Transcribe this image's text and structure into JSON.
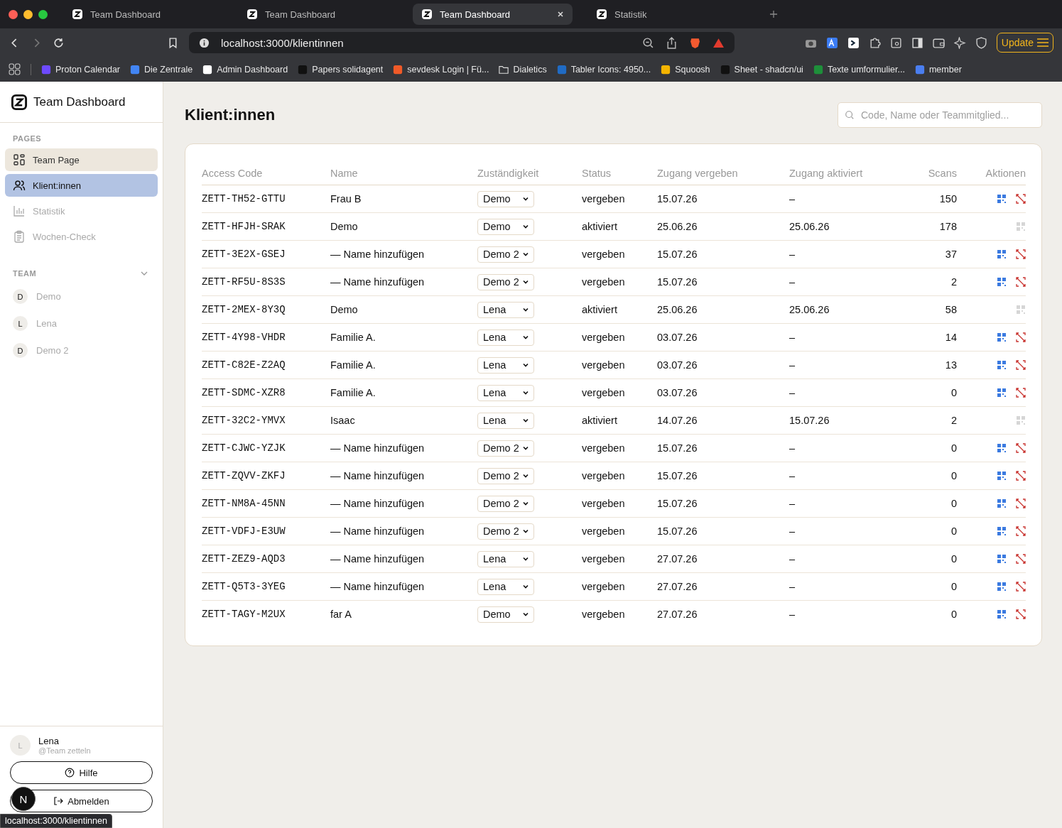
{
  "browser": {
    "tabs": [
      {
        "title": "Team Dashboard",
        "selected": false
      },
      {
        "title": "Team Dashboard",
        "selected": false
      },
      {
        "title": "Team Dashboard",
        "selected": true
      },
      {
        "title": "Statistik",
        "selected": false
      }
    ],
    "address": "localhost:3000/klientinnen",
    "update_button": "Update",
    "bookmarks": [
      {
        "label": "Proton Calendar",
        "kind": "site",
        "color": "#6d4aff"
      },
      {
        "label": "Die Zentrale",
        "kind": "site",
        "color": "#4285f4"
      },
      {
        "label": "Admin Dashboard",
        "kind": "site",
        "color": "#ffffff"
      },
      {
        "label": "Papers solidagent",
        "kind": "site",
        "color": "#111111"
      },
      {
        "label": "sevdesk Login | Fü...",
        "kind": "site",
        "color": "#f05a28"
      },
      {
        "label": "Dialetics",
        "kind": "folder",
        "color": "#dddddd"
      },
      {
        "label": "Tabler Icons: 4950...",
        "kind": "site",
        "color": "#206bc4"
      },
      {
        "label": "Squoosh",
        "kind": "site",
        "color": "#f4b400"
      },
      {
        "label": "Sheet - shadcn/ui",
        "kind": "site",
        "color": "#111111"
      },
      {
        "label": "Texte umformulier...",
        "kind": "site",
        "color": "#1e8f3a"
      },
      {
        "label": "member",
        "kind": "site",
        "color": "#4a7ef0"
      }
    ]
  },
  "sidebar": {
    "title": "Team Dashboard",
    "pages_heading": "PAGES",
    "pages": [
      {
        "label": "Team Page",
        "selected": false,
        "hovered": true
      },
      {
        "label": "Klient:innen",
        "selected": true,
        "hovered": false
      },
      {
        "label": "Statistik",
        "selected": false,
        "hovered": false
      },
      {
        "label": "Wochen-Check",
        "selected": false,
        "hovered": false
      }
    ],
    "team_heading": "TEAM",
    "team_expanded": true,
    "team": [
      {
        "initial": "D",
        "name": "Demo"
      },
      {
        "initial": "L",
        "name": "Lena"
      },
      {
        "initial": "D",
        "name": "Demo 2"
      }
    ],
    "user": {
      "initial": "L",
      "name": "Lena",
      "handle": "@Team zetteln"
    },
    "help_button": "Hilfe",
    "logout_button": "Abmelden"
  },
  "page": {
    "title": "Klient:innen",
    "search": {
      "placeholder": "Code, Name oder Teammitglied..."
    }
  },
  "table": {
    "columns": [
      "Access Code",
      "Name",
      "Zuständigkeit",
      "Status",
      "Zugang vergeben",
      "Zugang aktiviert",
      "Scans",
      "Aktionen"
    ],
    "rows": [
      {
        "code": "ZETT-TH52-GTTU",
        "name": "Frau B",
        "assignee": "Demo",
        "status": "vergeben",
        "issued": "15.07.26",
        "activated": "–",
        "scans": "150",
        "actions_enabled": true
      },
      {
        "code": "ZETT-HFJH-SRAK",
        "name": "Demo",
        "assignee": "Demo",
        "status": "aktiviert",
        "issued": "25.06.26",
        "activated": "25.06.26",
        "scans": "178",
        "actions_enabled": false
      },
      {
        "code": "ZETT-3E2X-GSEJ",
        "name": "— Name hinzufügen",
        "assignee": "Demo 2",
        "status": "vergeben",
        "issued": "15.07.26",
        "activated": "–",
        "scans": "37",
        "actions_enabled": true
      },
      {
        "code": "ZETT-RF5U-8S3S",
        "name": "— Name hinzufügen",
        "assignee": "Demo 2",
        "status": "vergeben",
        "issued": "15.07.26",
        "activated": "–",
        "scans": "2",
        "actions_enabled": true
      },
      {
        "code": "ZETT-2MEX-8Y3Q",
        "name": "Demo",
        "assignee": "Lena",
        "status": "aktiviert",
        "issued": "25.06.26",
        "activated": "25.06.26",
        "scans": "58",
        "actions_enabled": false
      },
      {
        "code": "ZETT-4Y98-VHDR",
        "name": "Familie A.",
        "assignee": "Lena",
        "status": "vergeben",
        "issued": "03.07.26",
        "activated": "–",
        "scans": "14",
        "actions_enabled": true
      },
      {
        "code": "ZETT-C82E-Z2AQ",
        "name": "Familie A.",
        "assignee": "Lena",
        "status": "vergeben",
        "issued": "03.07.26",
        "activated": "–",
        "scans": "13",
        "actions_enabled": true
      },
      {
        "code": "ZETT-SDMC-XZR8",
        "name": "Familie A.",
        "assignee": "Lena",
        "status": "vergeben",
        "issued": "03.07.26",
        "activated": "–",
        "scans": "0",
        "actions_enabled": true
      },
      {
        "code": "ZETT-32C2-YMVX",
        "name": "Isaac",
        "assignee": "Lena",
        "status": "aktiviert",
        "issued": "14.07.26",
        "activated": "15.07.26",
        "scans": "2",
        "actions_enabled": false
      },
      {
        "code": "ZETT-CJWC-YZJK",
        "name": "— Name hinzufügen",
        "assignee": "Demo 2",
        "status": "vergeben",
        "issued": "15.07.26",
        "activated": "–",
        "scans": "0",
        "actions_enabled": true
      },
      {
        "code": "ZETT-ZQVV-ZKFJ",
        "name": "— Name hinzufügen",
        "assignee": "Demo 2",
        "status": "vergeben",
        "issued": "15.07.26",
        "activated": "–",
        "scans": "0",
        "actions_enabled": true
      },
      {
        "code": "ZETT-NM8A-45NN",
        "name": "— Name hinzufügen",
        "assignee": "Demo 2",
        "status": "vergeben",
        "issued": "15.07.26",
        "activated": "–",
        "scans": "0",
        "actions_enabled": true
      },
      {
        "code": "ZETT-VDFJ-E3UW",
        "name": "— Name hinzufügen",
        "assignee": "Demo 2",
        "status": "vergeben",
        "issued": "15.07.26",
        "activated": "–",
        "scans": "0",
        "actions_enabled": true
      },
      {
        "code": "ZETT-ZEZ9-AQD3",
        "name": "— Name hinzufügen",
        "assignee": "Lena",
        "status": "vergeben",
        "issued": "27.07.26",
        "activated": "–",
        "scans": "0",
        "actions_enabled": true
      },
      {
        "code": "ZETT-Q5T3-3YEG",
        "name": "— Name hinzufügen",
        "assignee": "Lena",
        "status": "vergeben",
        "issued": "27.07.26",
        "activated": "–",
        "scans": "0",
        "actions_enabled": true
      },
      {
        "code": "ZETT-TAGY-M2UX",
        "name": "far A",
        "assignee": "Demo",
        "status": "vergeben",
        "issued": "27.07.26",
        "activated": "–",
        "scans": "0",
        "actions_enabled": true
      }
    ]
  },
  "overlay": {
    "dev_badge": "N",
    "status_url": "localhost:3000/klientinnen"
  }
}
